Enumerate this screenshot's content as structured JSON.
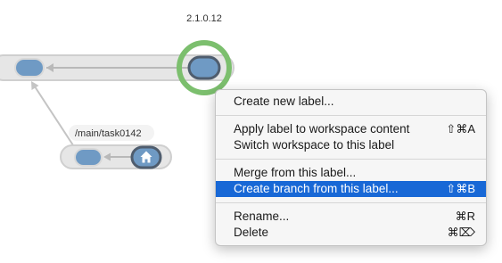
{
  "graph": {
    "version_label": "2.1.0.12",
    "branch_label": "/main/task0142",
    "home_icon": "home-icon",
    "colors": {
      "changeset_fill": "#6f9ac4",
      "lane": "#cfcfcf",
      "selection_ring": "#7cbf6e"
    }
  },
  "context_menu": {
    "items": [
      {
        "label": "Create new label...",
        "shortcut": ""
      },
      {
        "label": "Apply label to workspace content",
        "shortcut": "⇧⌘A"
      },
      {
        "label": "Switch workspace to this label",
        "shortcut": ""
      },
      {
        "label": "Merge from this label...",
        "shortcut": ""
      },
      {
        "label": "Create branch from this label...",
        "shortcut": "⇧⌘B",
        "highlighted": true
      },
      {
        "label": "Rename...",
        "shortcut": "⌘R"
      },
      {
        "label": "Delete",
        "shortcut": "⌘⌦"
      }
    ],
    "highlight_color": "#1868d6"
  }
}
